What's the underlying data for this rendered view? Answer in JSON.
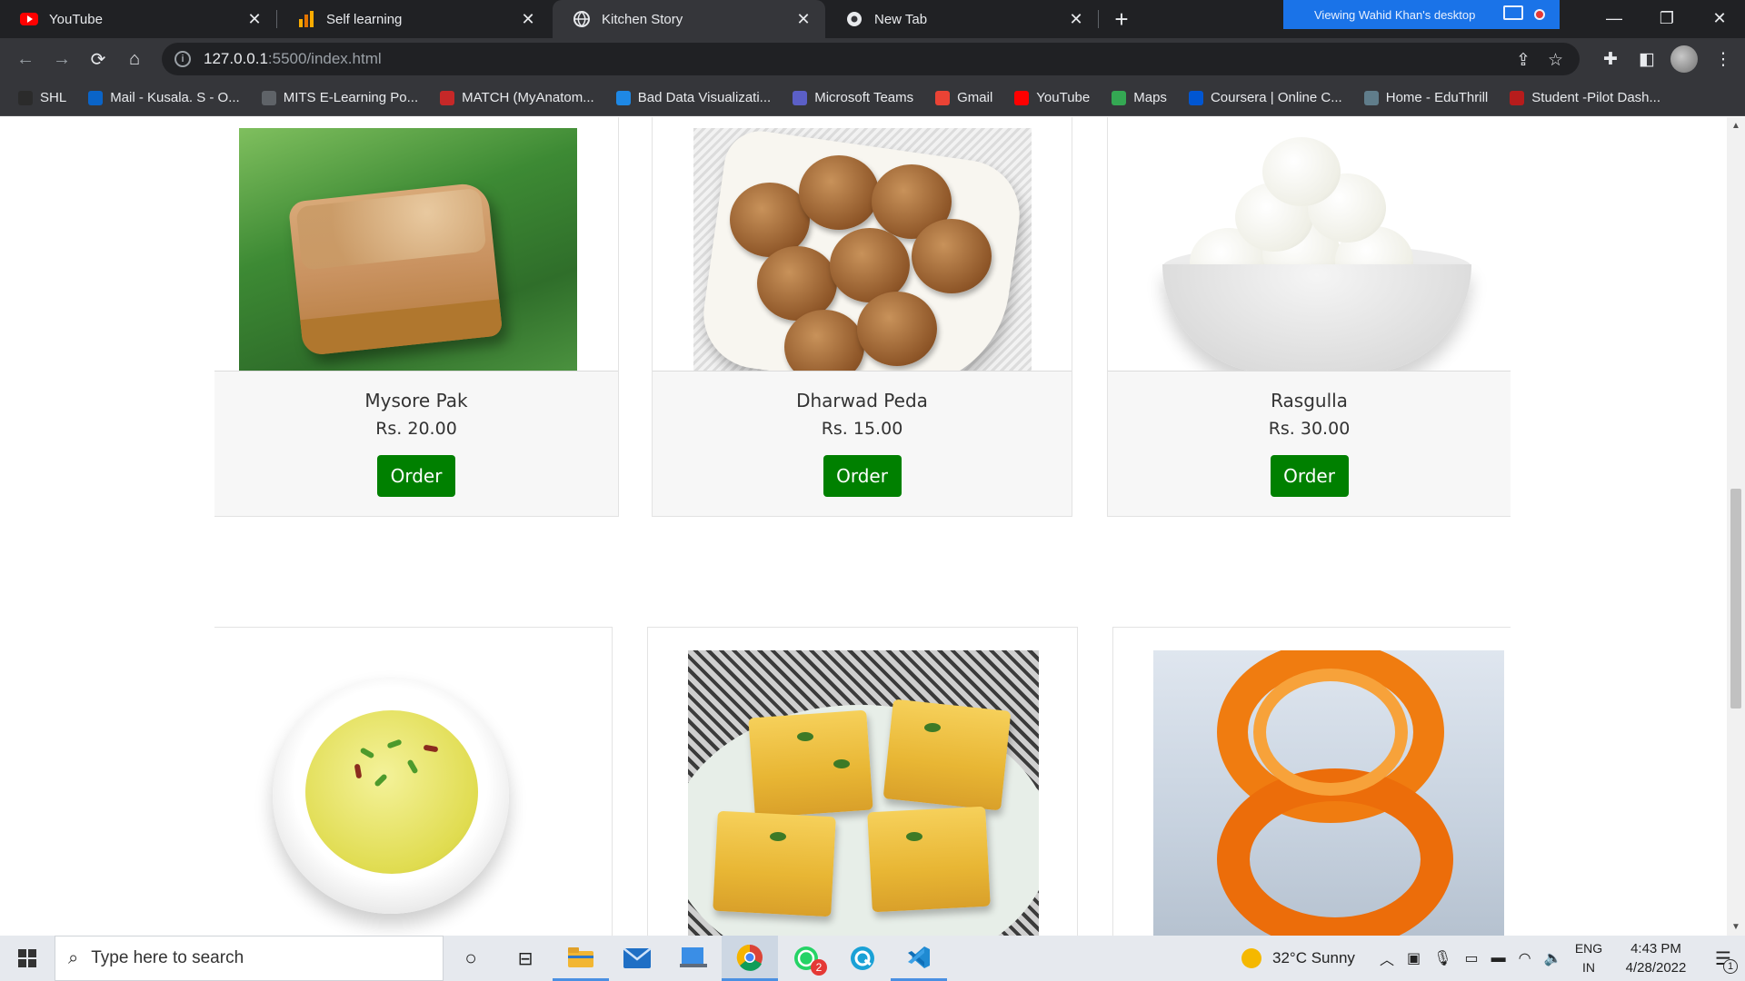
{
  "browser": {
    "tabs": [
      {
        "label": "YouTube",
        "icon": "youtube-icon",
        "active": false
      },
      {
        "label": "Self learning",
        "icon": "analytics-icon",
        "active": false
      },
      {
        "label": "Kitchen Story",
        "icon": "globe-icon",
        "active": true
      },
      {
        "label": "New Tab",
        "icon": "chrome-icon",
        "active": false
      }
    ],
    "remote_banner": "Viewing Wahid Khan's desktop",
    "url_host": "127.0.0.1",
    "url_path": ":5500/index.html",
    "bookmarks": [
      {
        "label": "SHL",
        "icon": "shl-icon",
        "color": "#2b2b2b"
      },
      {
        "label": "Mail - Kusala. S - O...",
        "icon": "outlook-icon",
        "color": "#0a64c8"
      },
      {
        "label": "MITS E-Learning Po...",
        "icon": "globe-icon",
        "color": "#5f6368"
      },
      {
        "label": "MATCH (MyAnatom...",
        "icon": "match-icon",
        "color": "#c62828"
      },
      {
        "label": "Bad Data Visualizati...",
        "icon": "dash-icon",
        "color": "#1e88e5"
      },
      {
        "label": "Microsoft Teams",
        "icon": "teams-icon",
        "color": "#5b5fc7"
      },
      {
        "label": "Gmail",
        "icon": "gmail-icon",
        "color": "#ea4335"
      },
      {
        "label": "YouTube",
        "icon": "youtube-icon",
        "color": "#ff0000"
      },
      {
        "label": "Maps",
        "icon": "maps-icon",
        "color": "#34a853"
      },
      {
        "label": "Coursera | Online C...",
        "icon": "coursera-icon",
        "color": "#0056d2"
      },
      {
        "label": "Home - EduThrill",
        "icon": "eduthrill-icon",
        "color": "#607d8b"
      },
      {
        "label": "Student -Pilot Dash...",
        "icon": "student-icon",
        "color": "#b71c1c"
      }
    ]
  },
  "products": [
    {
      "name": "Mysore Pak",
      "price": "Rs. 20.00",
      "button": "Order"
    },
    {
      "name": "Dharwad Peda",
      "price": "Rs. 15.00",
      "button": "Order"
    },
    {
      "name": "Rasgulla",
      "price": "Rs. 30.00",
      "button": "Order"
    }
  ],
  "taskbar": {
    "search_placeholder": "Type here to search",
    "weather": "32°C  Sunny",
    "lang_top": "ENG",
    "lang_bottom": "IN",
    "time": "4:43 PM",
    "date": "4/28/2022",
    "whatsapp_badge": "2",
    "notification_count": "1"
  },
  "colors": {
    "order_button": "#008000",
    "chrome_dark": "#202124",
    "chrome_toolbar": "#35363a"
  }
}
